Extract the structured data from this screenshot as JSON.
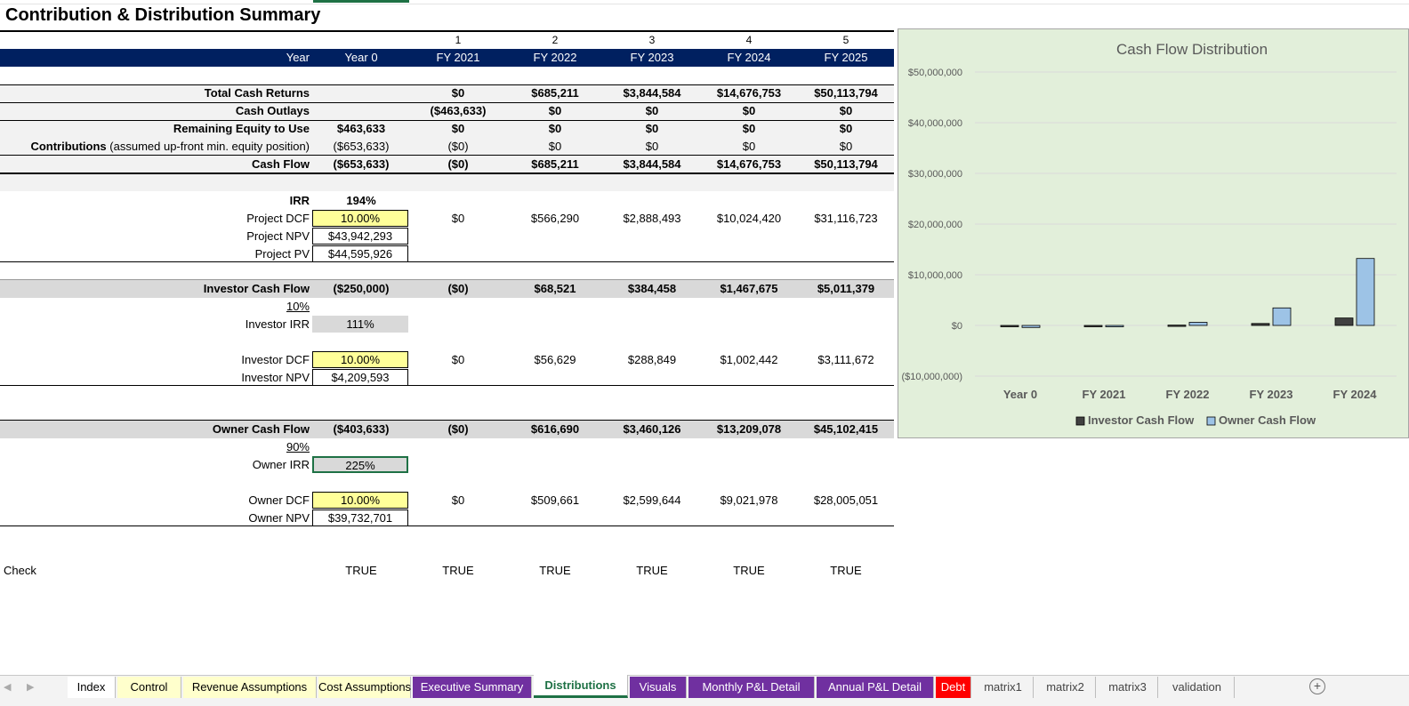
{
  "sheet_title": "Contribution & Distribution Summary",
  "header": {
    "period_numbers": [
      "1",
      "2",
      "3",
      "4",
      "5"
    ],
    "year_label": "Year",
    "years": [
      "Year 0",
      "FY 2021",
      "FY 2022",
      "FY 2023",
      "FY 2024",
      "FY 2025"
    ]
  },
  "rows": {
    "total_cash_returns": {
      "label": "Total Cash Returns",
      "values": [
        "",
        "$0",
        "$685,211",
        "$3,844,584",
        "$14,676,753",
        "$50,113,794"
      ]
    },
    "cash_outlays": {
      "label": "Cash Outlays",
      "values": [
        "",
        "($463,633)",
        "$0",
        "$0",
        "$0",
        "$0"
      ]
    },
    "remaining_equity": {
      "label": "Remaining Equity to Use",
      "values": [
        "$463,633",
        "$0",
        "$0",
        "$0",
        "$0",
        "$0"
      ]
    },
    "contributions": {
      "label_bold": "Contributions",
      "label_rest": " (assumed up-front min. equity position)",
      "values": [
        "($653,633)",
        "($0)",
        "$0",
        "$0",
        "$0",
        "$0"
      ]
    },
    "cash_flow": {
      "label": "Cash Flow",
      "values": [
        "($653,633)",
        "($0)",
        "$685,211",
        "$3,844,584",
        "$14,676,753",
        "$50,113,794"
      ]
    }
  },
  "project": {
    "irr_label": "IRR",
    "irr": "194%",
    "dcf_label": "Project DCF",
    "dcf": "10.00%",
    "dcf_values": [
      "$0",
      "$566,290",
      "$2,888,493",
      "$10,024,420",
      "$31,116,723"
    ],
    "npv_label": "Project NPV",
    "npv": "$43,942,293",
    "pv_label": "Project PV",
    "pv": "$44,595,926"
  },
  "investor": {
    "cf_label": "Investor Cash Flow",
    "cf_values": [
      "($250,000)",
      "($0)",
      "$68,521",
      "$384,458",
      "$1,467,675",
      "$5,011,379"
    ],
    "share": "10%",
    "irr_label": "Investor IRR",
    "irr": "111%",
    "dcf_label": "Investor DCF",
    "dcf": "10.00%",
    "dcf_values": [
      "$0",
      "$56,629",
      "$288,849",
      "$1,002,442",
      "$3,111,672"
    ],
    "npv_label": "Investor NPV",
    "npv": "$4,209,593"
  },
  "owner": {
    "cf_label": "Owner Cash Flow",
    "cf_values": [
      "($403,633)",
      "($0)",
      "$616,690",
      "$3,460,126",
      "$13,209,078",
      "$45,102,415"
    ],
    "share": "90%",
    "irr_label": "Owner IRR",
    "irr": "225%",
    "dcf_label": "Owner DCF",
    "dcf": "10.00%",
    "dcf_values": [
      "$0",
      "$509,661",
      "$2,599,644",
      "$9,021,978",
      "$28,005,051"
    ],
    "npv_label": "Owner NPV",
    "npv": "$39,732,701"
  },
  "check": {
    "label": "Check",
    "values": [
      "TRUE",
      "TRUE",
      "TRUE",
      "TRUE",
      "TRUE",
      "TRUE"
    ]
  },
  "chart_data": {
    "type": "bar",
    "title": "Cash Flow Distribution",
    "categories": [
      "Year 0",
      "FY 2021",
      "FY 2022",
      "FY 2023",
      "FY 2024"
    ],
    "series": [
      {
        "name": "Investor Cash Flow",
        "values": [
          -250000,
          0,
          68521,
          384458,
          1467675
        ],
        "color": "#404040"
      },
      {
        "name": "Owner Cash Flow",
        "values": [
          -403633,
          0,
          616690,
          3460126,
          13209078
        ],
        "color": "#9dc3e6"
      }
    ],
    "ylim": [
      -10000000,
      50000000
    ],
    "yticks": [
      50000000,
      40000000,
      30000000,
      20000000,
      10000000,
      0,
      -10000000
    ],
    "ytick_labels": [
      "$50,000,000",
      "$40,000,000",
      "$30,000,000",
      "$20,000,000",
      "$10,000,000",
      "$0",
      "($10,000,000)"
    ],
    "legend": "bottom",
    "grid": true
  },
  "tabs": [
    {
      "label": "Index",
      "bg": "#ffffff",
      "fg": "#000000"
    },
    {
      "label": "Control",
      "bg": "#ffffcc",
      "fg": "#000000"
    },
    {
      "label": "Revenue Assumptions",
      "bg": "#ffffcc",
      "fg": "#000000"
    },
    {
      "label": "Cost Assumptions",
      "bg": "#ffffcc",
      "fg": "#000000"
    },
    {
      "label": "Executive Summary",
      "bg": "#7030a0",
      "fg": "#ffffff"
    },
    {
      "label": "Distributions",
      "bg": "#ffffff",
      "fg": "#1e7145",
      "active": true
    },
    {
      "label": "Visuals",
      "bg": "#7030a0",
      "fg": "#ffffff"
    },
    {
      "label": "Monthly P&L Detail",
      "bg": "#7030a0",
      "fg": "#ffffff"
    },
    {
      "label": "Annual P&L Detail",
      "bg": "#7030a0",
      "fg": "#ffffff"
    },
    {
      "label": "Debt",
      "bg": "#ff0000",
      "fg": "#ffffff"
    },
    {
      "label": "matrix1",
      "bg": "#f3f3f3",
      "fg": "#444444"
    },
    {
      "label": "matrix2",
      "bg": "#f3f3f3",
      "fg": "#444444"
    },
    {
      "label": "matrix3",
      "bg": "#f3f3f3",
      "fg": "#444444"
    },
    {
      "label": "validation",
      "bg": "#f3f3f3",
      "fg": "#444444"
    }
  ]
}
